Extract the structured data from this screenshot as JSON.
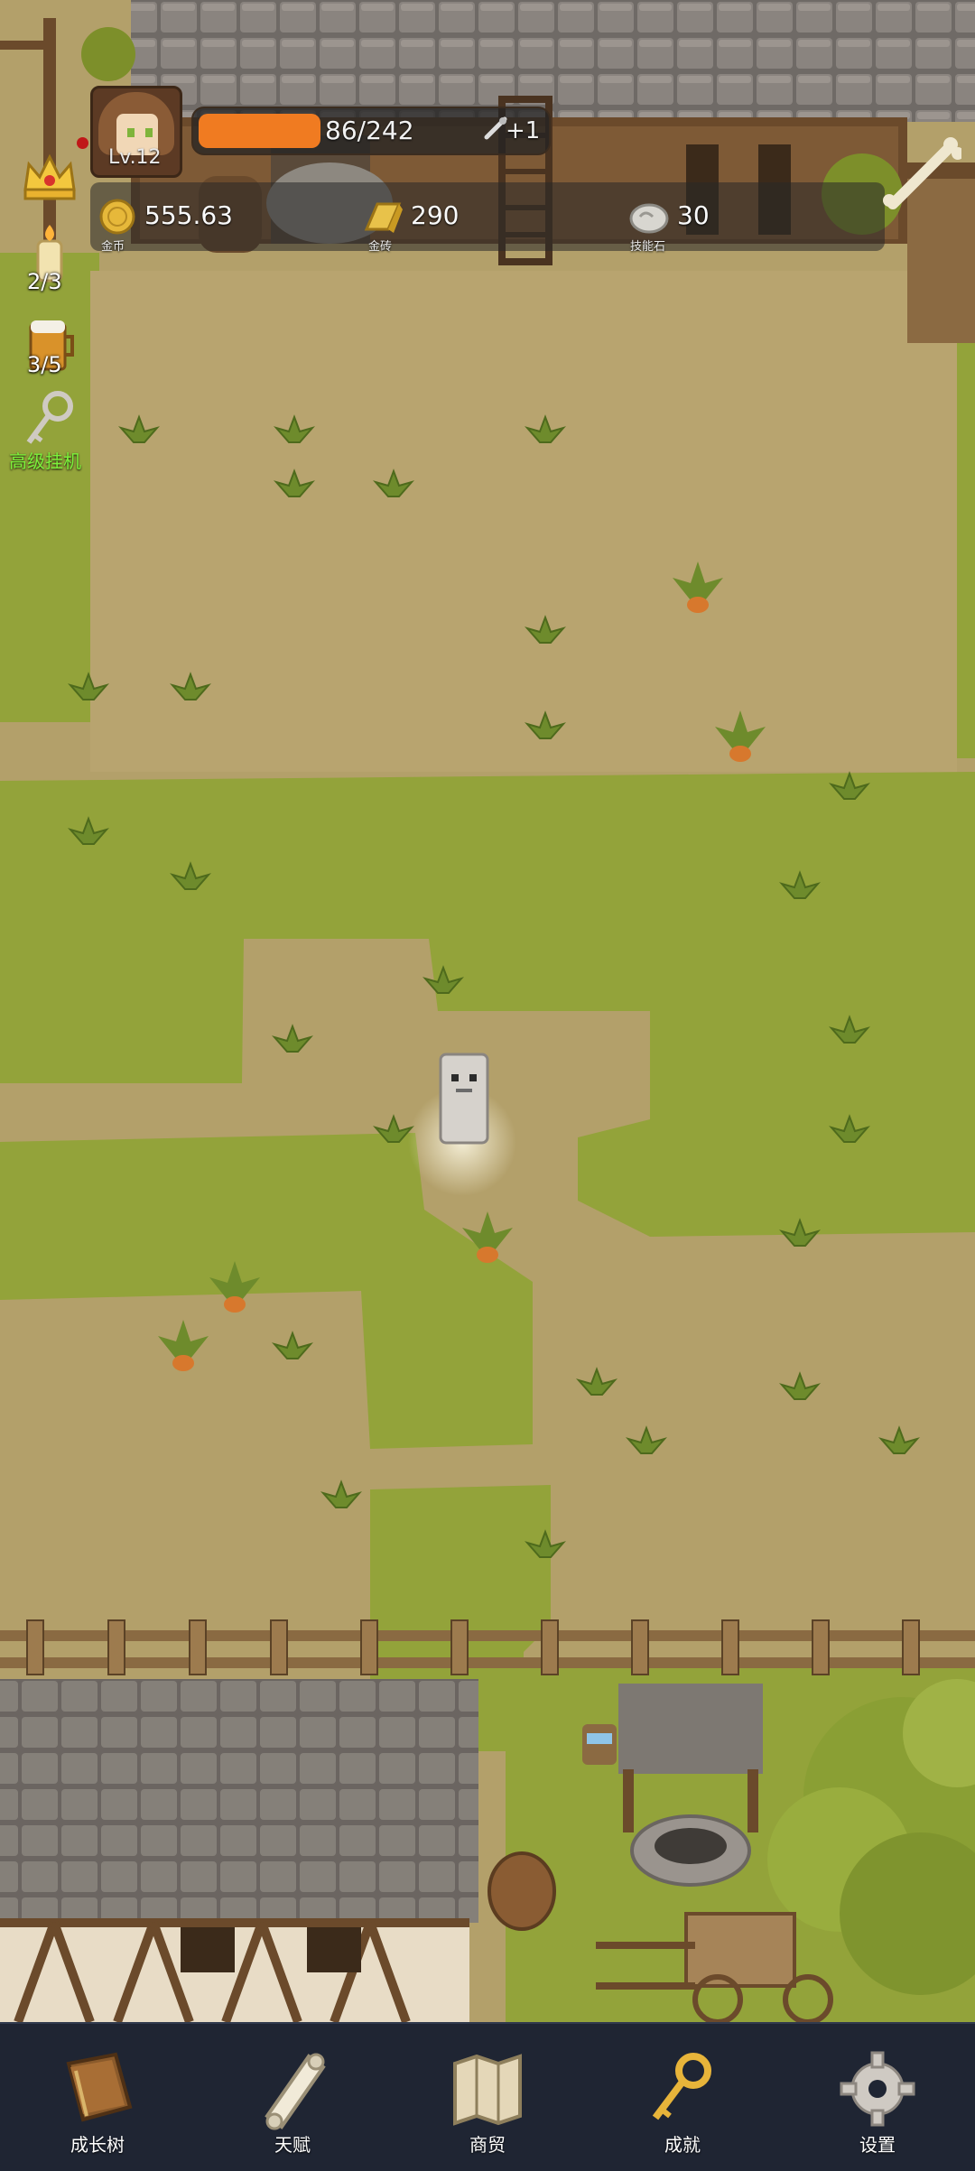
{
  "player": {
    "level": "Lv.12",
    "hp_text": "86/242",
    "hp_fraction": 0.355,
    "hp_bonus": "+1"
  },
  "resources": [
    {
      "icon": "gold-coin-icon",
      "value": "555.63",
      "label": "金币"
    },
    {
      "icon": "gold-brick-icon",
      "value": "290",
      "label": "金砖"
    },
    {
      "icon": "skill-stone-icon",
      "value": "30",
      "label": "技能石"
    }
  ],
  "side": {
    "candle_count": "2/3",
    "beer_count": "3/5",
    "idle_label": "高级挂机"
  },
  "nav": [
    {
      "icon": "book-icon",
      "label": "成长树"
    },
    {
      "icon": "scroll-icon",
      "label": "天赋"
    },
    {
      "icon": "map-icon",
      "label": "商贸"
    },
    {
      "icon": "key-icon",
      "label": "成就"
    },
    {
      "icon": "gear-icon",
      "label": "设置"
    }
  ],
  "colors": {
    "hp_fill": "#f07b21",
    "idle_text": "#7cf23b",
    "nav_bg": "#1f2533",
    "dirt": "#b3a06a",
    "grass": "#93a33a"
  }
}
